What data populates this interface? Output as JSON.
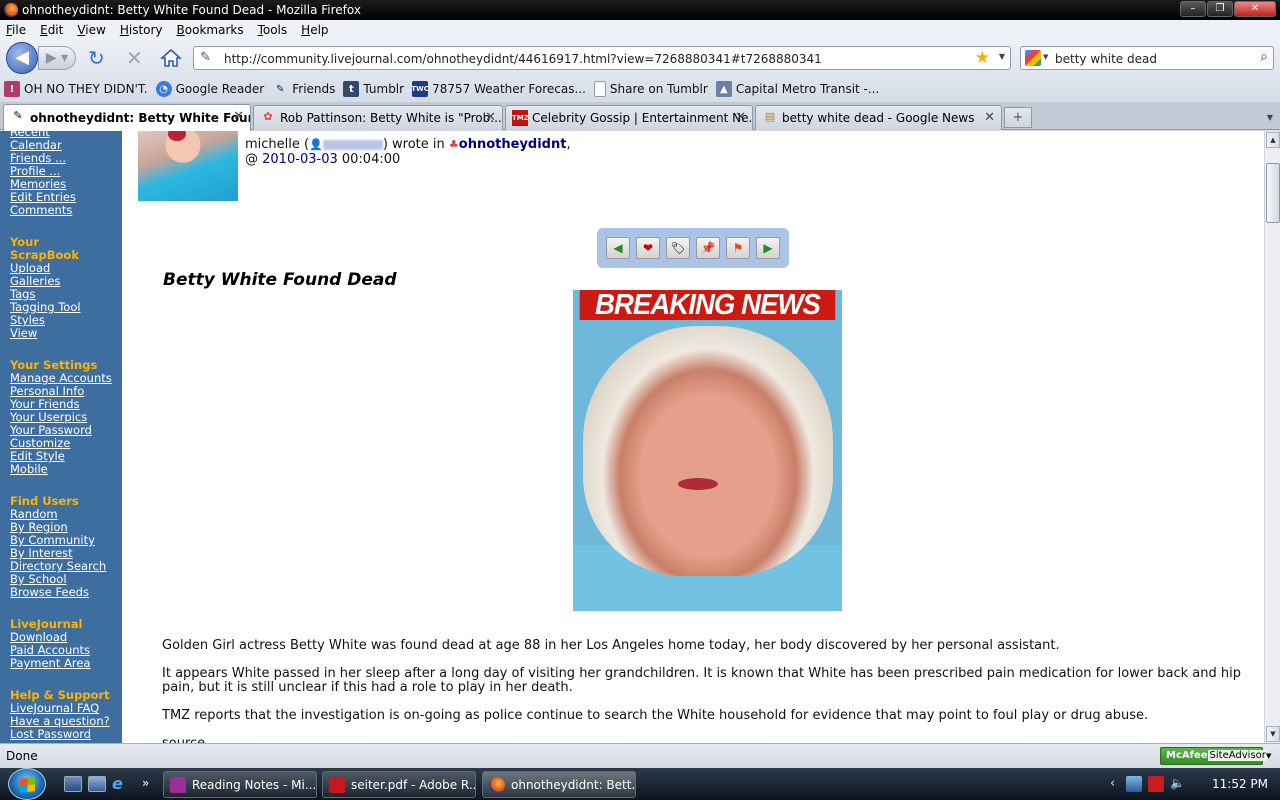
{
  "window": {
    "title": "ohnotheydidnt: Betty White Found Dead - Mozilla Firefox"
  },
  "menu": [
    "File",
    "Edit",
    "View",
    "History",
    "Bookmarks",
    "Tools",
    "Help"
  ],
  "nav": {
    "url": "http://community.livejournal.com/ohnotheydidnt/44616917.html?view=7268880341#t7268880341",
    "search_query": "betty white dead"
  },
  "bookmarks": [
    {
      "label": "OH NO THEY DIDN'T.",
      "icon": "ontd-icon"
    },
    {
      "label": "Google Reader",
      "icon": "google-reader-icon"
    },
    {
      "label": "Friends",
      "icon": "livejournal-pencil-icon"
    },
    {
      "label": "Tumblr",
      "icon": "tumblr-icon"
    },
    {
      "label": "78757 Weather Forecas...",
      "icon": "twc-icon"
    },
    {
      "label": "Share on Tumblr",
      "icon": "page-icon"
    },
    {
      "label": "Capital Metro Transit -...",
      "icon": "transit-icon"
    }
  ],
  "tabs": [
    {
      "label": "ohnotheydidnt: Betty White Foun...",
      "active": true
    },
    {
      "label": "Rob Pattinson: Betty White is \"Prob...",
      "active": false
    },
    {
      "label": "Celebrity Gossip | Entertainment Ne...",
      "active": false
    },
    {
      "label": "betty white dead - Google News",
      "active": false
    }
  ],
  "sidebar": {
    "top_links": [
      "Recent",
      "Calendar",
      "Friends ...",
      "Profile ...",
      "Memories",
      "Edit Entries",
      "Comments"
    ],
    "scrapbook": {
      "heading": "Your ScrapBook",
      "links": [
        "Upload",
        "Galleries",
        "Tags",
        "Tagging Tool",
        "Styles",
        "View"
      ]
    },
    "settings": {
      "heading": "Your Settings",
      "links": [
        "Manage Accounts",
        "Personal Info",
        "Your Friends",
        "Your Userpics",
        "Your Password",
        "Customize",
        "Edit Style",
        "Mobile"
      ]
    },
    "find_users": {
      "heading": "Find Users",
      "links": [
        "Random",
        "By Region",
        "By Community",
        "By Interest",
        "Directory Search",
        "By School",
        "Browse Feeds"
      ]
    },
    "livejournal": {
      "heading": "LiveJournal",
      "links": [
        "Download",
        "Paid Accounts",
        "Payment Area"
      ]
    },
    "help": {
      "heading": "Help & Support",
      "links": [
        "LiveJournal FAQ",
        "Have a question?",
        "Lost Password"
      ]
    }
  },
  "post": {
    "author_name": "michelle",
    "wrote_in": "wrote in",
    "community": "ohnotheydidnt",
    "date_prefix": "@",
    "year": "2010",
    "month": "03",
    "day": "03",
    "time": "00:04:00",
    "title": "Betty White Found Dead",
    "image_banner": "BREAKING NEWS",
    "paragraphs": [
      "Golden Girl actress Betty White was found dead at age 88 in her Los Angeles home today, her body discovered by her personal assistant.",
      "It appears White passed in her sleep after a long day of visiting her grandchildren. It is known that White has been prescribed pain medication for lower back and hip pain, but it is still unclear if this had a role to play in her death.",
      "TMZ reports that the investigation is on-going as police continue to search the White household for evidence that may point to foul play or drug abuse.",
      "source"
    ]
  },
  "status": {
    "text": "Done",
    "mcafee": "McAfee",
    "siteadvisor": "SiteAdvisor"
  },
  "taskbar": {
    "buttons": [
      {
        "label": "Reading Notes - Mi...",
        "active": false
      },
      {
        "label": "seiter.pdf - Adobe R...",
        "active": false
      },
      {
        "label": "ohnotheydidnt: Bett...",
        "active": true
      }
    ],
    "clock": "11:52 PM"
  }
}
